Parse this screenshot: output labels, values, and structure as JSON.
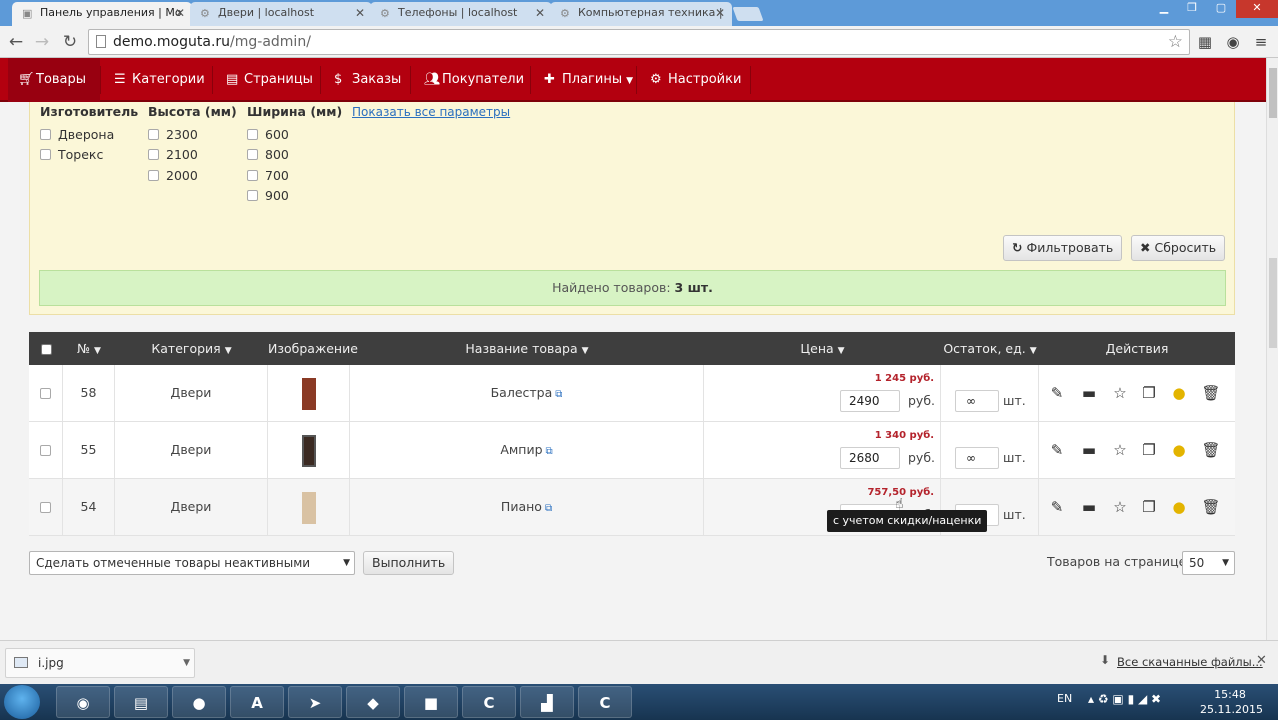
{
  "browser": {
    "tabs": [
      {
        "label": "Панель управления | Mo",
        "active": true
      },
      {
        "label": "Двери | localhost",
        "active": false
      },
      {
        "label": "Телефоны | localhost",
        "active": false
      },
      {
        "label": "Компьютерная техника |",
        "active": false
      }
    ],
    "url_host": "demo.moguta.ru",
    "url_path": "/mg-admin/"
  },
  "nav": {
    "items": [
      {
        "label": "Товары"
      },
      {
        "label": "Категории"
      },
      {
        "label": "Страницы"
      },
      {
        "label": "Заказы"
      },
      {
        "label": "Покупатели"
      },
      {
        "label": "Плагины"
      },
      {
        "label": "Настройки"
      }
    ]
  },
  "filters": {
    "groups": [
      {
        "title": "Изготовитель",
        "options": [
          "Дверона",
          "Торекс"
        ]
      },
      {
        "title": "Высота (мм)",
        "options": [
          "2300",
          "2100",
          "2000"
        ]
      },
      {
        "title": "Ширина (мм)",
        "options": [
          "600",
          "800",
          "700",
          "900"
        ]
      }
    ],
    "show_all": "Показать все параметры",
    "filter_btn": "Фильтровать",
    "reset_btn": "Сбросить",
    "found_label": "Найдено товаров:",
    "found_value": "3 шт."
  },
  "table": {
    "headers": {
      "num": "№",
      "category": "Категория",
      "image": "Изображение",
      "name": "Название товара",
      "price": "Цена",
      "stock": "Остаток, ед.",
      "actions": "Действия"
    },
    "rows": [
      {
        "id": "58",
        "category": "Двери",
        "name": "Балестра",
        "price_discount": "1 245 руб.",
        "price": "2490",
        "currency": "руб.",
        "stock": "∞",
        "stock_unit": "шт.",
        "img_color": "#8a3a25"
      },
      {
        "id": "55",
        "category": "Двери",
        "name": "Ампир",
        "price_discount": "1 340 руб.",
        "price": "2680",
        "currency": "руб.",
        "stock": "∞",
        "stock_unit": "шт.",
        "img_color": "#3b2a22"
      },
      {
        "id": "54",
        "category": "Двери",
        "name": "Пиано",
        "price_discount": "757,50 руб.",
        "price": "1515",
        "currency": "руб.",
        "stock": "∞",
        "stock_unit": "шт.",
        "img_color": "#d9c2a3"
      }
    ],
    "tooltip": "с учетом скидки/наценки"
  },
  "bulk": {
    "selected": "Сделать отмеченные товары неактивными",
    "execute": "Выполнить",
    "per_page_label": "Товаров на странице:",
    "per_page_value": "50"
  },
  "downloads": {
    "file": "i.jpg",
    "all_label": "Все скачанные файлы..."
  },
  "taskbar": {
    "lang": "EN",
    "time": "15:48",
    "date": "25.11.2015"
  }
}
